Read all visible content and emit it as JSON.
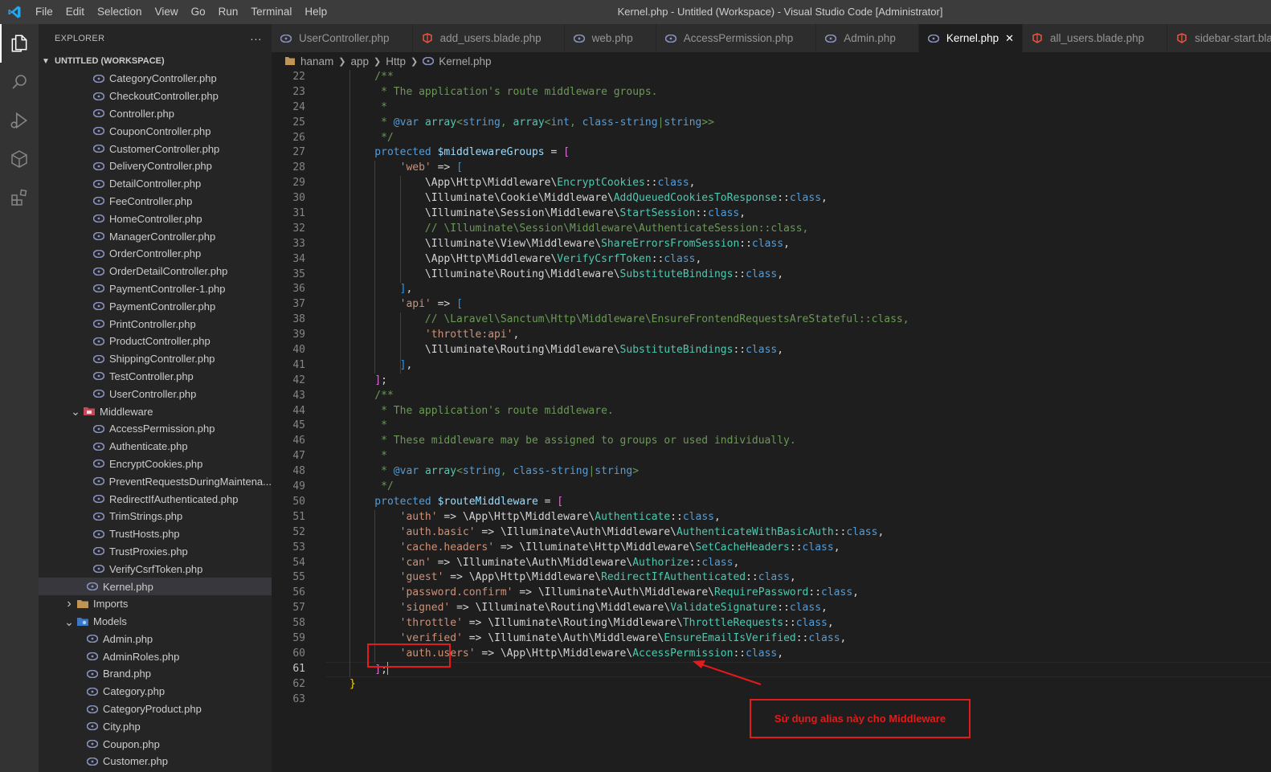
{
  "titlebar": {
    "menu": [
      "File",
      "Edit",
      "Selection",
      "View",
      "Go",
      "Run",
      "Terminal",
      "Help"
    ],
    "window_title": "Kernel.php - Untitled (Workspace) - Visual Studio Code [Administrator]"
  },
  "activitybar": {
    "items": [
      "explorer-icon",
      "search-icon",
      "run-debug-icon",
      "remote-icon",
      "extensions-icon"
    ]
  },
  "sidebar": {
    "title": "EXPLORER",
    "more": "···",
    "workspace": "UNTITLED (WORKSPACE)",
    "controllers": [
      "CategoryController.php",
      "CheckoutController.php",
      "Controller.php",
      "CouponController.php",
      "CustomerController.php",
      "DeliveryController.php",
      "DetailController.php",
      "FeeController.php",
      "HomeController.php",
      "ManagerController.php",
      "OrderController.php",
      "OrderDetailController.php",
      "PaymentController-1.php",
      "PaymentController.php",
      "PrintController.php",
      "ProductController.php",
      "ShippingController.php",
      "TestController.php",
      "UserController.php"
    ],
    "middleware_folder": "Middleware",
    "middleware": [
      "AccessPermission.php",
      "Authenticate.php",
      "EncryptCookies.php",
      "PreventRequestsDuringMaintena...",
      "RedirectIfAuthenticated.php",
      "TrimStrings.php",
      "TrustHosts.php",
      "TrustProxies.php",
      "VerifyCsrfToken.php"
    ],
    "kernel": "Kernel.php",
    "imports_folder": "Imports",
    "models_folder": "Models",
    "models": [
      "Admin.php",
      "AdminRoles.php",
      "Brand.php",
      "Category.php",
      "CategoryProduct.php",
      "City.php",
      "Coupon.php",
      "Customer.php"
    ]
  },
  "tabs": [
    {
      "label": "UserController.php",
      "icon": "php"
    },
    {
      "label": "add_users.blade.php",
      "icon": "blade"
    },
    {
      "label": "web.php",
      "icon": "php"
    },
    {
      "label": "AccessPermission.php",
      "icon": "php"
    },
    {
      "label": "Admin.php",
      "icon": "php"
    },
    {
      "label": "Kernel.php",
      "icon": "php",
      "active": true
    },
    {
      "label": "all_users.blade.php",
      "icon": "blade"
    },
    {
      "label": "sidebar-start.blade.php",
      "icon": "blade"
    }
  ],
  "breadcrumb": [
    "hanam",
    "app",
    "Http",
    "Kernel.php"
  ],
  "editor": {
    "first_line": 22,
    "current_line": 61,
    "lines": [
      [
        [
          "c-comment",
          "    /**"
        ]
      ],
      [
        [
          "c-comment",
          "     * The application's route middleware groups."
        ]
      ],
      [
        [
          "c-comment",
          "     *"
        ]
      ],
      [
        [
          "c-comment",
          "     * "
        ],
        [
          "c-kw",
          "@var"
        ],
        [
          "c-comment",
          " "
        ],
        [
          "c-cls",
          "array"
        ],
        [
          "c-comment",
          "<"
        ],
        [
          "c-kw",
          "string"
        ],
        [
          "c-comment",
          ", "
        ],
        [
          "c-cls",
          "array"
        ],
        [
          "c-comment",
          "<"
        ],
        [
          "c-kw",
          "int"
        ],
        [
          "c-comment",
          ", "
        ],
        [
          "c-kw",
          "class-string"
        ],
        [
          "c-comment",
          "|"
        ],
        [
          "c-kw",
          "string"
        ],
        [
          "c-comment",
          ">>"
        ]
      ],
      [
        [
          "c-comment",
          "     */"
        ]
      ],
      [
        [
          "c-kw",
          "    protected "
        ],
        [
          "c-var",
          "$middlewareGroups"
        ],
        [
          "c-op",
          " = "
        ],
        [
          "c-bracket1",
          "["
        ]
      ],
      [
        [
          "c-op",
          "        "
        ],
        [
          "c-str",
          "'web'"
        ],
        [
          "c-op",
          " => "
        ],
        [
          "c-bracket2",
          "["
        ]
      ],
      [
        [
          "c-op",
          "            \\App\\Http\\Middleware\\"
        ],
        [
          "c-cls",
          "EncryptCookies"
        ],
        [
          "c-op",
          "::"
        ],
        [
          "c-kw",
          "class"
        ],
        [
          "c-op",
          ","
        ]
      ],
      [
        [
          "c-op",
          "            \\Illuminate\\Cookie\\Middleware\\"
        ],
        [
          "c-cls",
          "AddQueuedCookiesToResponse"
        ],
        [
          "c-op",
          "::"
        ],
        [
          "c-kw",
          "class"
        ],
        [
          "c-op",
          ","
        ]
      ],
      [
        [
          "c-op",
          "            \\Illuminate\\Session\\Middleware\\"
        ],
        [
          "c-cls",
          "StartSession"
        ],
        [
          "c-op",
          "::"
        ],
        [
          "c-kw",
          "class"
        ],
        [
          "c-op",
          ","
        ]
      ],
      [
        [
          "c-comment",
          "            // \\Illuminate\\Session\\Middleware\\AuthenticateSession::class,"
        ]
      ],
      [
        [
          "c-op",
          "            \\Illuminate\\View\\Middleware\\"
        ],
        [
          "c-cls",
          "ShareErrorsFromSession"
        ],
        [
          "c-op",
          "::"
        ],
        [
          "c-kw",
          "class"
        ],
        [
          "c-op",
          ","
        ]
      ],
      [
        [
          "c-op",
          "            \\App\\Http\\Middleware\\"
        ],
        [
          "c-cls",
          "VerifyCsrfToken"
        ],
        [
          "c-op",
          "::"
        ],
        [
          "c-kw",
          "class"
        ],
        [
          "c-op",
          ","
        ]
      ],
      [
        [
          "c-op",
          "            \\Illuminate\\Routing\\Middleware\\"
        ],
        [
          "c-cls",
          "SubstituteBindings"
        ],
        [
          "c-op",
          "::"
        ],
        [
          "c-kw",
          "class"
        ],
        [
          "c-op",
          ","
        ]
      ],
      [
        [
          "c-op",
          "        "
        ],
        [
          "c-bracket2",
          "]"
        ],
        [
          "c-op",
          ","
        ]
      ],
      [
        [
          "c-op",
          "        "
        ],
        [
          "c-str",
          "'api'"
        ],
        [
          "c-op",
          " => "
        ],
        [
          "c-bracket2",
          "["
        ]
      ],
      [
        [
          "c-comment",
          "            // \\Laravel\\Sanctum\\Http\\Middleware\\EnsureFrontendRequestsAreStateful::class,"
        ]
      ],
      [
        [
          "c-op",
          "            "
        ],
        [
          "c-str",
          "'throttle:api'"
        ],
        [
          "c-op",
          ","
        ]
      ],
      [
        [
          "c-op",
          "            \\Illuminate\\Routing\\Middleware\\"
        ],
        [
          "c-cls",
          "SubstituteBindings"
        ],
        [
          "c-op",
          "::"
        ],
        [
          "c-kw",
          "class"
        ],
        [
          "c-op",
          ","
        ]
      ],
      [
        [
          "c-op",
          "        "
        ],
        [
          "c-bracket2",
          "]"
        ],
        [
          "c-op",
          ","
        ]
      ],
      [
        [
          "c-op",
          "    "
        ],
        [
          "c-bracket1",
          "]"
        ],
        [
          "c-op",
          ";"
        ]
      ],
      [
        [
          "c-comment",
          "    /**"
        ]
      ],
      [
        [
          "c-comment",
          "     * The application's route middleware."
        ]
      ],
      [
        [
          "c-comment",
          "     *"
        ]
      ],
      [
        [
          "c-comment",
          "     * These middleware may be assigned to groups or used individually."
        ]
      ],
      [
        [
          "c-comment",
          "     *"
        ]
      ],
      [
        [
          "c-comment",
          "     * "
        ],
        [
          "c-kw",
          "@var"
        ],
        [
          "c-comment",
          " "
        ],
        [
          "c-cls",
          "array"
        ],
        [
          "c-comment",
          "<"
        ],
        [
          "c-kw",
          "string"
        ],
        [
          "c-comment",
          ", "
        ],
        [
          "c-kw",
          "class-string"
        ],
        [
          "c-comment",
          "|"
        ],
        [
          "c-kw",
          "string"
        ],
        [
          "c-comment",
          ">"
        ]
      ],
      [
        [
          "c-comment",
          "     */"
        ]
      ],
      [
        [
          "c-kw",
          "    protected "
        ],
        [
          "c-var",
          "$routeMiddleware"
        ],
        [
          "c-op",
          " = "
        ],
        [
          "c-bracket1",
          "["
        ]
      ],
      [
        [
          "c-op",
          "        "
        ],
        [
          "c-str",
          "'auth'"
        ],
        [
          "c-op",
          " => \\App\\Http\\Middleware\\"
        ],
        [
          "c-cls",
          "Authenticate"
        ],
        [
          "c-op",
          "::"
        ],
        [
          "c-kw",
          "class"
        ],
        [
          "c-op",
          ","
        ]
      ],
      [
        [
          "c-op",
          "        "
        ],
        [
          "c-str",
          "'auth.basic'"
        ],
        [
          "c-op",
          " => \\Illuminate\\Auth\\Middleware\\"
        ],
        [
          "c-cls",
          "AuthenticateWithBasicAuth"
        ],
        [
          "c-op",
          "::"
        ],
        [
          "c-kw",
          "class"
        ],
        [
          "c-op",
          ","
        ]
      ],
      [
        [
          "c-op",
          "        "
        ],
        [
          "c-str",
          "'cache.headers'"
        ],
        [
          "c-op",
          " => \\Illuminate\\Http\\Middleware\\"
        ],
        [
          "c-cls",
          "SetCacheHeaders"
        ],
        [
          "c-op",
          "::"
        ],
        [
          "c-kw",
          "class"
        ],
        [
          "c-op",
          ","
        ]
      ],
      [
        [
          "c-op",
          "        "
        ],
        [
          "c-str",
          "'can'"
        ],
        [
          "c-op",
          " => \\Illuminate\\Auth\\Middleware\\"
        ],
        [
          "c-cls",
          "Authorize"
        ],
        [
          "c-op",
          "::"
        ],
        [
          "c-kw",
          "class"
        ],
        [
          "c-op",
          ","
        ]
      ],
      [
        [
          "c-op",
          "        "
        ],
        [
          "c-str",
          "'guest'"
        ],
        [
          "c-op",
          " => \\App\\Http\\Middleware\\"
        ],
        [
          "c-cls",
          "RedirectIfAuthenticated"
        ],
        [
          "c-op",
          "::"
        ],
        [
          "c-kw",
          "class"
        ],
        [
          "c-op",
          ","
        ]
      ],
      [
        [
          "c-op",
          "        "
        ],
        [
          "c-str",
          "'password.confirm'"
        ],
        [
          "c-op",
          " => \\Illuminate\\Auth\\Middleware\\"
        ],
        [
          "c-cls",
          "RequirePassword"
        ],
        [
          "c-op",
          "::"
        ],
        [
          "c-kw",
          "class"
        ],
        [
          "c-op",
          ","
        ]
      ],
      [
        [
          "c-op",
          "        "
        ],
        [
          "c-str",
          "'signed'"
        ],
        [
          "c-op",
          " => \\Illuminate\\Routing\\Middleware\\"
        ],
        [
          "c-cls",
          "ValidateSignature"
        ],
        [
          "c-op",
          "::"
        ],
        [
          "c-kw",
          "class"
        ],
        [
          "c-op",
          ","
        ]
      ],
      [
        [
          "c-op",
          "        "
        ],
        [
          "c-str",
          "'throttle'"
        ],
        [
          "c-op",
          " => \\Illuminate\\Routing\\Middleware\\"
        ],
        [
          "c-cls",
          "ThrottleRequests"
        ],
        [
          "c-op",
          "::"
        ],
        [
          "c-kw",
          "class"
        ],
        [
          "c-op",
          ","
        ]
      ],
      [
        [
          "c-op",
          "        "
        ],
        [
          "c-str",
          "'verified'"
        ],
        [
          "c-op",
          " => \\Illuminate\\Auth\\Middleware\\"
        ],
        [
          "c-cls",
          "EnsureEmailIsVerified"
        ],
        [
          "c-op",
          "::"
        ],
        [
          "c-kw",
          "class"
        ],
        [
          "c-op",
          ","
        ]
      ],
      [
        [
          "c-op",
          "        "
        ],
        [
          "c-str",
          "'auth.users'"
        ],
        [
          "c-op",
          " => \\App\\Http\\Middleware\\"
        ],
        [
          "c-cls",
          "AccessPermission"
        ],
        [
          "c-op",
          "::"
        ],
        [
          "c-kw",
          "class"
        ],
        [
          "c-op",
          ","
        ]
      ],
      [
        [
          "c-op",
          "    "
        ],
        [
          "c-bracket1",
          "]"
        ],
        [
          "c-op",
          ";"
        ]
      ],
      [
        [
          "c-bracket3",
          "}"
        ]
      ],
      [
        [
          "c-op",
          ""
        ]
      ]
    ]
  },
  "annotation": {
    "note": "Sử dụng alias này cho Middleware",
    "color": "#e51a1a"
  },
  "colors": {
    "titlebar": "#3c3c3c",
    "activitybar": "#333333",
    "sidebar": "#252526",
    "editor": "#1e1e1e",
    "vscode_blue": "#23a9f2"
  }
}
